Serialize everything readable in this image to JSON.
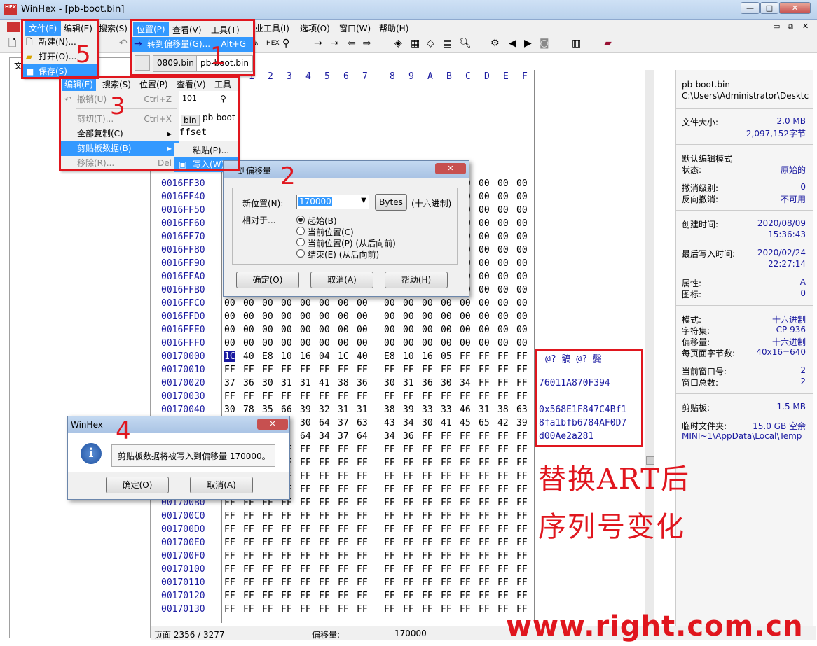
{
  "window": {
    "title": "WinHex - [pb-boot.bin]",
    "icon_text": "HEX"
  },
  "menubar": [
    "文件(F)",
    "编辑(E)",
    "搜索(S)",
    "位置(P)",
    "查看(V)",
    "工具(T)",
    "专业工具(I)",
    "选项(O)",
    "窗口(W)",
    "帮助(H)"
  ],
  "tabs": [
    "0809.bin",
    "pb-boot.bin"
  ],
  "hex_header": [
    "0",
    "1",
    "2",
    "3",
    "4",
    "5",
    "6",
    "7",
    "8",
    "9",
    "A",
    "B",
    "C",
    "D",
    "E",
    "F"
  ],
  "rows": [
    {
      "off": "0016FF30",
      "bytes": "00 00 00 00 00 00 00 00 00 00 00 00 00 00 00 00"
    },
    {
      "off": "0016FF40",
      "bytes": "00 00 00 00 00 00 00 00 00 00 00 00 00 00 00 00"
    },
    {
      "off": "0016FF50",
      "bytes": "00 00 00 00 00 00 00 00 00 00 00 00 00 00 00 00"
    },
    {
      "off": "0016FF60",
      "bytes": "00 00 00 00 00 00 00 00 00 00 00 00 00 00 00 00"
    },
    {
      "off": "0016FF70",
      "bytes": "00 00 00 00 00 00 00 00 00 00 00 00 00 00 00 00"
    },
    {
      "off": "0016FF80",
      "bytes": "00 00 00 00 00 00 00 00 00 00 00 00 00 00 00 00"
    },
    {
      "off": "0016FF90",
      "bytes": "00 00 00 00 00 00 00 00 00 00 00 00 00 00 00 00"
    },
    {
      "off": "0016FFA0",
      "bytes": "00 00 00 00 00 00 00 00 00 00 00 00 00 00 00 00"
    },
    {
      "off": "0016FFB0",
      "bytes": "00 00 00 00 00 00 00 00 00 00 00 00 00 00 00 00"
    },
    {
      "off": "0016FFC0",
      "bytes": "00 00 00 00 00 00 00 00 00 00 00 00 00 00 00 00"
    },
    {
      "off": "0016FFD0",
      "bytes": "00 00 00 00 00 00 00 00 00 00 00 00 00 00 00 00"
    },
    {
      "off": "0016FFE0",
      "bytes": "00 00 00 00 00 00 00 00 00 00 00 00 00 00 00 00"
    },
    {
      "off": "0016FFF0",
      "bytes": "00 00 00 00 00 00 00 00 00 00 00 00 00 00 00 00"
    },
    {
      "off": "00170000",
      "bytes": "1C 40 E8 10 16 04 1C 40 E8 10 16 05 FF FF FF FF"
    },
    {
      "off": "00170010",
      "bytes": "FF FF FF FF FF FF FF FF FF FF FF FF FF FF FF FF"
    },
    {
      "off": "00170020",
      "bytes": "37 36 30 31 31 41 38 36 30 31 36 30 34 FF FF FF"
    },
    {
      "off": "00170030",
      "bytes": "FF FF FF FF FF FF FF FF FF FF FF FF FF FF FF FF"
    },
    {
      "off": "00170040",
      "bytes": "30 78 35 66 39 32 31 31 38 39 33 33 46 31 38 63"
    },
    {
      "off": "",
      "bytes": "      30 64 37 63 43 34 30 41 45 65 42 39"
    },
    {
      "off": "",
      "bytes": "      64 34 37 64 34 36 FF FF FF FF FF FF"
    },
    {
      "off": "",
      "bytes": "   FF FF FF FF FF FF FF FF FF FF FF FF FF"
    },
    {
      "off": "",
      "bytes": "   FF FF FF FF FF FF FF FF FF FF FF FF FF"
    },
    {
      "off": "",
      "bytes": "   FF FF FF FF FF FF FF FF FF FF FF FF FF"
    },
    {
      "off": "",
      "bytes": "   FF FF FF FF FF FF FF FF FF FF FF FF FF"
    },
    {
      "off": "001700B0",
      "bytes": "FF FF FF FF FF FF FF FF FF FF FF FF FF FF FF FF"
    },
    {
      "off": "001700C0",
      "bytes": "FF FF FF FF FF FF FF FF FF FF FF FF FF FF FF FF"
    },
    {
      "off": "001700D0",
      "bytes": "FF FF FF FF FF FF FF FF FF FF FF FF FF FF FF FF"
    },
    {
      "off": "001700E0",
      "bytes": "FF FF FF FF FF FF FF FF FF FF FF FF FF FF FF FF"
    },
    {
      "off": "001700F0",
      "bytes": "FF FF FF FF FF FF FF FF FF FF FF FF FF FF FF FF"
    },
    {
      "off": "00170100",
      "bytes": "FF FF FF FF FF FF FF FF FF FF FF FF FF FF FF FF"
    },
    {
      "off": "00170110",
      "bytes": "FF FF FF FF FF FF FF FF FF FF FF FF FF FF FF FF"
    },
    {
      "off": "00170120",
      "bytes": "FF FF FF FF FF FF FF FF FF FF FF FF FF FF FF FF"
    },
    {
      "off": "00170130",
      "bytes": "FF FF FF FF FF FF FF FF FF FF FF FF FF FF FF FF"
    }
  ],
  "ascii": {
    "line1": "@? 髇 @? 鬓",
    "line2": "76011A870F394",
    "line3": "0x568E1F847C4Bf1",
    "line4": "8fa1bfb6784AF0D7",
    "line5": "d00Ae2a281"
  },
  "info": {
    "filename": "pb-boot.bin",
    "path": "C:\\Users\\Administrator\\Desktc",
    "size_label": "文件大小:",
    "size_mb": "2.0 MB",
    "size_bytes": "2,097,152字节",
    "edit_mode_label": "默认编辑模式",
    "state_label": "状态:",
    "state": "原始的",
    "undo_label": "撤消级别:",
    "undo": "0",
    "redo_label": "反向撤消:",
    "redo": "不可用",
    "created_label": "创建时间:",
    "created_date": "2020/08/09",
    "created_time": "15:36:43",
    "written_label": "最后写入时间:",
    "written_date": "2020/02/24",
    "written_time": "22:27:14",
    "attr_label": "属性:",
    "attr": "A",
    "icon_label": "图标:",
    "icon": "0",
    "mode_label": "模式:",
    "mode": "十六进制",
    "charset_label": "字符集:",
    "charset": "CP 936",
    "offset_label": "偏移量:",
    "offset": "十六进制",
    "bpp_label": "每页面字节数:",
    "bpp": "40x16=640",
    "curwin_label": "当前窗口号:",
    "curwin": "2",
    "totwin_label": "窗口总数:",
    "totwin": "2",
    "clip_label": "剪贴板:",
    "clip": "1.5 MB",
    "temp_label": "临时文件夹:",
    "temp": "15.0 GB 空余",
    "temp_path": "MINI~1\\AppData\\Local\\Temp"
  },
  "status": {
    "page": "页面 2356 / 3277",
    "offset_label": "偏移量:",
    "offset": "170000"
  },
  "menu_file": {
    "header": "文件(F)",
    "header2": "编辑(E)",
    "items": [
      "新建(N)...",
      "打开(O)...",
      "保存(S)"
    ]
  },
  "menu_pos": {
    "header": "位置(P)",
    "header2": "查看(V)",
    "header3": "工具(T)",
    "item": "转到偏移量(G)...",
    "shortcut": "Alt+G"
  },
  "menu_edit": {
    "bar": [
      "编辑(E)",
      "搜索(S)",
      "位置(P)",
      "查看(V)",
      "工具(T"
    ],
    "items": [
      {
        "label": "撤销(U)",
        "key": "Ctrl+Z"
      },
      {
        "label": "剪切(T)...",
        "key": "Ctrl+X"
      },
      {
        "label": "全部复制(C)",
        "key": "▸"
      },
      {
        "label": "剪贴板数据(B)",
        "key": "▸"
      },
      {
        "label": "移除(R)...",
        "key": "Del"
      }
    ],
    "sub": [
      "粘贴(P)...",
      "写入(W)..."
    ],
    "offset_label": "ffset"
  },
  "goto_dialog": {
    "title": "到偏移量",
    "new_pos_label": "新位置(N):",
    "value": "170000",
    "bytes_btn": "Bytes",
    "hex_label": "(十六进制)",
    "relative_label": "相对于...",
    "options": [
      "起始(B)",
      "当前位置(C)",
      "当前位置(P) (从后向前)",
      "结束(E) (从后向前)"
    ],
    "ok": "确定(O)",
    "cancel": "取消(A)",
    "help": "帮助(H)"
  },
  "msg_dialog": {
    "title": "WinHex",
    "message": "剪贴板数据将被写入到偏移量 170000。",
    "ok": "确定(O)",
    "cancel": "取消(A)"
  },
  "annotations": {
    "n1": "1",
    "n2": "2",
    "n3": "3",
    "n4": "4",
    "n5": "5",
    "caption1": "替换ART后",
    "caption2": "序列号变化",
    "watermark": "www.right.com.cn"
  }
}
